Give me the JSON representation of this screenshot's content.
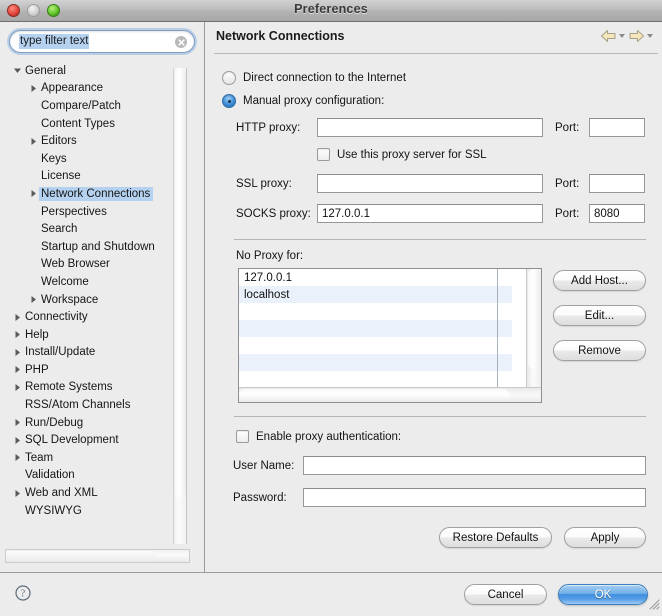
{
  "window": {
    "title": "Preferences",
    "traffic_lights": [
      "close-button",
      "minimize-button",
      "zoom-button"
    ]
  },
  "sidebar": {
    "filter": {
      "value": "type filter text",
      "placeholder": "type filter text",
      "clear_icon": "clear-icon"
    },
    "tree": [
      {
        "label": "General",
        "indent": 0,
        "twisty": "down",
        "selected": false
      },
      {
        "label": "Appearance",
        "indent": 1,
        "twisty": "right",
        "selected": false
      },
      {
        "label": "Compare/Patch",
        "indent": 1,
        "twisty": "none",
        "selected": false
      },
      {
        "label": "Content Types",
        "indent": 1,
        "twisty": "none",
        "selected": false
      },
      {
        "label": "Editors",
        "indent": 1,
        "twisty": "right",
        "selected": false
      },
      {
        "label": "Keys",
        "indent": 1,
        "twisty": "none",
        "selected": false
      },
      {
        "label": "License",
        "indent": 1,
        "twisty": "none",
        "selected": false
      },
      {
        "label": "Network Connections",
        "indent": 1,
        "twisty": "right",
        "selected": true
      },
      {
        "label": "Perspectives",
        "indent": 1,
        "twisty": "none",
        "selected": false
      },
      {
        "label": "Search",
        "indent": 1,
        "twisty": "none",
        "selected": false
      },
      {
        "label": "Startup and Shutdown",
        "indent": 1,
        "twisty": "none",
        "selected": false
      },
      {
        "label": "Web Browser",
        "indent": 1,
        "twisty": "none",
        "selected": false
      },
      {
        "label": "Welcome",
        "indent": 1,
        "twisty": "none",
        "selected": false
      },
      {
        "label": "Workspace",
        "indent": 1,
        "twisty": "right",
        "selected": false
      },
      {
        "label": "Connectivity",
        "indent": 0,
        "twisty": "right",
        "selected": false
      },
      {
        "label": "Help",
        "indent": 0,
        "twisty": "right",
        "selected": false
      },
      {
        "label": "Install/Update",
        "indent": 0,
        "twisty": "right",
        "selected": false
      },
      {
        "label": "PHP",
        "indent": 0,
        "twisty": "right",
        "selected": false
      },
      {
        "label": "Remote Systems",
        "indent": 0,
        "twisty": "right",
        "selected": false
      },
      {
        "label": "RSS/Atom Channels",
        "indent": 0,
        "twisty": "none",
        "selected": false
      },
      {
        "label": "Run/Debug",
        "indent": 0,
        "twisty": "right",
        "selected": false
      },
      {
        "label": "SQL Development",
        "indent": 0,
        "twisty": "right",
        "selected": false
      },
      {
        "label": "Team",
        "indent": 0,
        "twisty": "right",
        "selected": false
      },
      {
        "label": "Validation",
        "indent": 0,
        "twisty": "none",
        "selected": false
      },
      {
        "label": "Web and XML",
        "indent": 0,
        "twisty": "right",
        "selected": false
      },
      {
        "label": "WYSIWYG",
        "indent": 0,
        "twisty": "none",
        "selected": false
      }
    ]
  },
  "page": {
    "title": "Network Connections",
    "nav": {
      "back_icon": "back-arrow-icon",
      "forward_icon": "forward-arrow-icon"
    },
    "radios": {
      "direct": {
        "label": "Direct connection to the Internet",
        "checked": false
      },
      "manual": {
        "label": "Manual proxy configuration:",
        "checked": true
      }
    },
    "fields": {
      "http_proxy": {
        "label": "HTTP proxy:",
        "value": ""
      },
      "http_port": {
        "label": "Port:",
        "value": ""
      },
      "ssl_proxy": {
        "label": "SSL proxy:",
        "value": ""
      },
      "ssl_port": {
        "label": "Port:",
        "value": ""
      },
      "socks_proxy": {
        "label": "SOCKS proxy:",
        "value": "127.0.0.1"
      },
      "socks_port": {
        "label": "Port:",
        "value": "8080"
      },
      "user_name": {
        "label": "User Name:",
        "value": ""
      },
      "password": {
        "label": "Password:",
        "value": ""
      }
    },
    "use_proxy_for_ssl": {
      "label": "Use this proxy server for SSL",
      "checked": false
    },
    "no_proxy": {
      "label": "No Proxy for:",
      "hosts": [
        "127.0.0.1",
        "localhost",
        "",
        "",
        "",
        "",
        "",
        ""
      ]
    },
    "list_buttons": {
      "add_host": "Add Host...",
      "edit": "Edit...",
      "remove": "Remove"
    },
    "enable_auth": {
      "label": "Enable proxy authentication:",
      "checked": false
    },
    "page_buttons": {
      "restore_defaults": "Restore Defaults",
      "apply": "Apply"
    }
  },
  "footer": {
    "help_icon": "help-icon",
    "cancel": "Cancel",
    "ok": "OK",
    "resize_grip": "resize-grip-icon"
  },
  "colors": {
    "selection_blue": "#b4d2f0",
    "primary_button": "#3f8ee0",
    "list_stripe": "#eaf1fb",
    "nav_arrow": "#f2e4b4"
  }
}
